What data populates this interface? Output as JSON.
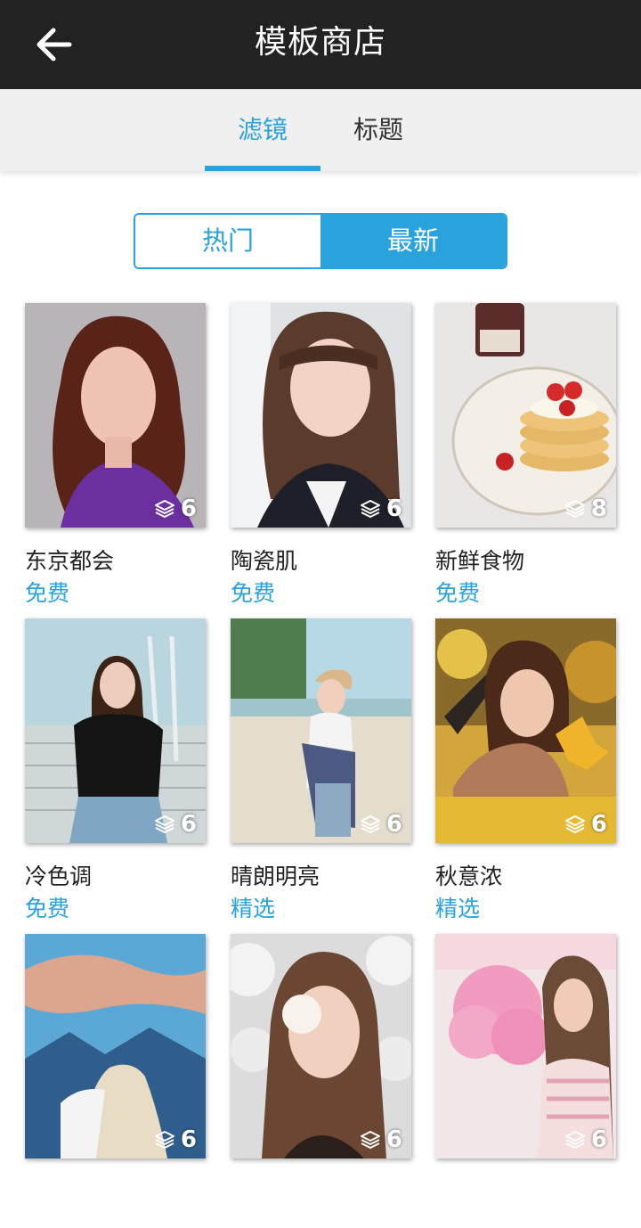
{
  "header": {
    "title": "模板商店",
    "back_icon": "arrow-left-icon"
  },
  "tabs": [
    {
      "label": "滤镜",
      "active": true
    },
    {
      "label": "标题",
      "active": false
    }
  ],
  "segment": {
    "hot_label": "热门",
    "new_label": "最新",
    "selected": "最新"
  },
  "colors": {
    "accent": "#2aa2dc",
    "topbar": "#222222",
    "tabbar": "#f0f0f0"
  },
  "templates": [
    {
      "name": "东京都会",
      "price": "免费",
      "layers": "6"
    },
    {
      "name": "陶瓷肌",
      "price": "免费",
      "layers": "6"
    },
    {
      "name": "新鲜食物",
      "price": "免费",
      "layers": "8"
    },
    {
      "name": "冷色调",
      "price": "免费",
      "layers": "6"
    },
    {
      "name": "晴朗明亮",
      "price": "精选",
      "layers": "6"
    },
    {
      "name": "秋意浓",
      "price": "精选",
      "layers": "6"
    },
    {
      "name": "",
      "price": "",
      "layers": "6"
    },
    {
      "name": "",
      "price": "",
      "layers": "6"
    },
    {
      "name": "",
      "price": "",
      "layers": "6"
    }
  ]
}
